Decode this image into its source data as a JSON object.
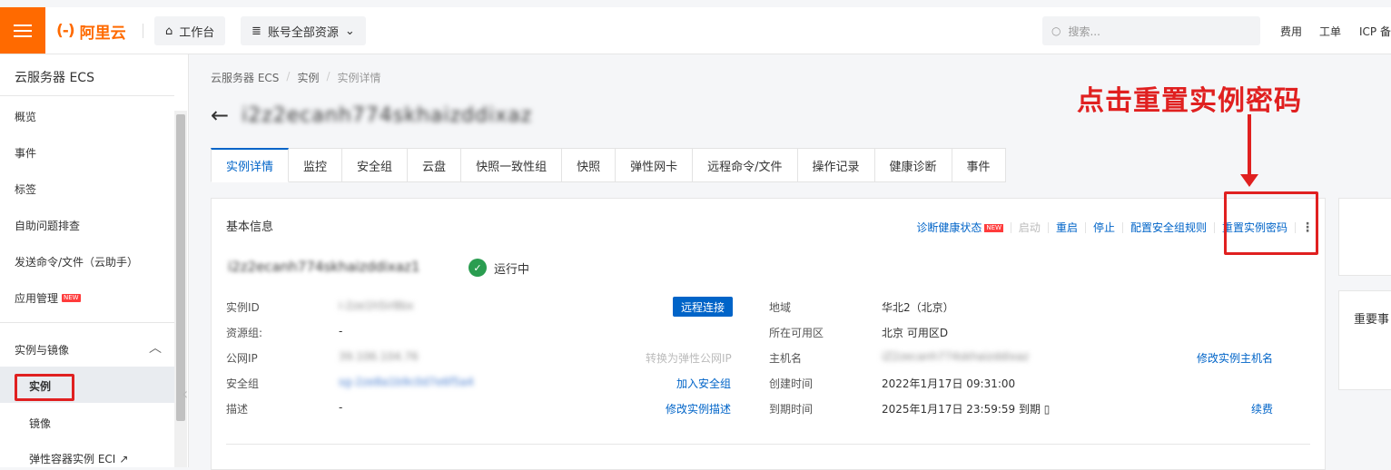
{
  "topbar": {
    "logo_text": "阿里云",
    "logo_mark": "(-)",
    "workbench": "工作台",
    "resources": "账号全部资源",
    "search_placeholder": "搜索...",
    "links": [
      "费用",
      "工单",
      "ICP 备"
    ]
  },
  "sidebar": {
    "title": "云服务器 ECS",
    "items": [
      "概览",
      "事件",
      "标签",
      "自助问题排查",
      "发送命令/文件（云助手）",
      "应用管理"
    ],
    "new_badge": "NEW",
    "group": "实例与镜像",
    "sub_items": [
      "实例",
      "镜像",
      "弹性容器实例 ECI"
    ]
  },
  "breadcrumb": [
    "云服务器 ECS",
    "实例",
    "实例详情"
  ],
  "page_title": "i2z2ecanh774skhaizddixaz",
  "tabs": [
    "实例详情",
    "监控",
    "安全组",
    "云盘",
    "快照一致性组",
    "快照",
    "弹性网卡",
    "远程命令/文件",
    "操作记录",
    "健康诊断",
    "事件"
  ],
  "card": {
    "title": "基本信息",
    "actions": {
      "diagnose": "诊断健康状态",
      "start": "启动",
      "restart": "重启",
      "stop": "停止",
      "config_sg": "配置安全组规则",
      "reset_password": "重置实例密码"
    },
    "instance_name": "i2z2ecanh774skhaizddixaz1",
    "status": "运行中",
    "left": {
      "instance_id_label": "实例ID",
      "instance_id_value": "i-2ze1h5ir8bx",
      "remote_btn": "远程连接",
      "resource_group_label": "资源组:",
      "resource_group_value": "-",
      "public_ip_label": "公网IP",
      "public_ip_value": "39.106.104.76",
      "convert_eip": "转换为弹性公网IP",
      "sg_label": "安全组",
      "sg_value": "sg-2ze8a1b9c0d7e6f5a4",
      "join_sg": "加入安全组",
      "desc_label": "描述",
      "desc_value": "-",
      "edit_desc": "修改实例描述"
    },
    "right": {
      "region_label": "地域",
      "region_value": "华北2（北京）",
      "zone_label": "所在可用区",
      "zone_value": "北京 可用区D",
      "hostname_label": "主机名",
      "hostname_value": "iZ2zecanh774skhaizddixaz",
      "edit_hostname": "修改实例主机名",
      "created_label": "创建时间",
      "created_value": "2022年1月17日 09:31:00",
      "expire_label": "到期时间",
      "expire_value": "2025年1月17日 23:59:59 到期",
      "renew": "续费"
    }
  },
  "side_card2_text": "重要事",
  "annotation": {
    "text": "点击重置实例密码",
    "color": "#e02020"
  },
  "colors": {
    "brand": "#ff6a00",
    "link": "#0064c8",
    "running": "#2a9d50"
  }
}
